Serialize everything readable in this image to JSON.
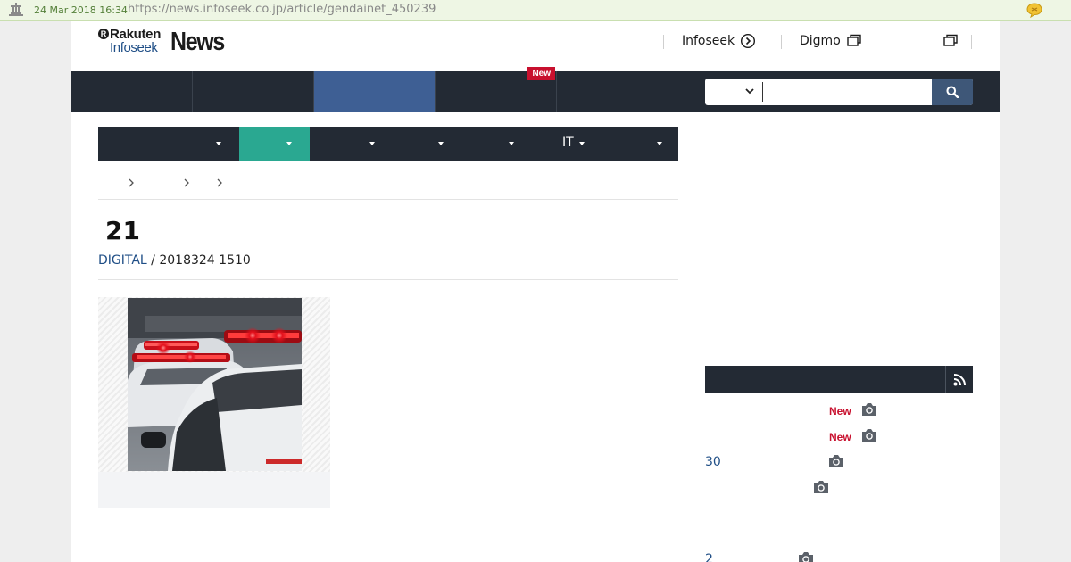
{
  "archive_bar": {
    "date": "24 Mar 2018 16:34",
    "url": "https://news.infoseek.co.jp/article/gendainet_450239"
  },
  "header": {
    "logo": {
      "rakuten": "Rakuten",
      "infoseek": "Infoseek",
      "news": "News"
    },
    "links": [
      {
        "label": "Infoseek",
        "icon": "arrow-circle-icon"
      },
      {
        "label": "Digmo",
        "icon": "external-window-icon"
      },
      {
        "label": "",
        "icon": "external-window-icon"
      }
    ]
  },
  "nav": {
    "tabs": [
      {
        "label": "",
        "active": false,
        "new": false
      },
      {
        "label": "",
        "active": false,
        "new": false
      },
      {
        "label": "",
        "active": true,
        "new": false
      },
      {
        "label": "",
        "active": false,
        "new": true
      },
      {
        "label": "",
        "active": false,
        "new": false
      }
    ],
    "new_badge": "New",
    "search": {
      "scope": "",
      "placeholder": "",
      "value": ""
    }
  },
  "categories": [
    {
      "label": "",
      "active": false
    },
    {
      "label": "",
      "active": true
    },
    {
      "label": "",
      "active": false
    },
    {
      "label": "",
      "active": false
    },
    {
      "label": "",
      "active": false
    },
    {
      "label": "IT",
      "active": false
    },
    {
      "label": "",
      "active": false
    }
  ],
  "breadcrumbs": [
    "",
    "",
    "",
    ""
  ],
  "article": {
    "title": "21",
    "source": "DIGITAL",
    "separator": " / ",
    "date": "2018324 1510"
  },
  "sidebar": {
    "ranking_title": "",
    "items": [
      {
        "num": "",
        "new": "New",
        "camera": true
      },
      {
        "num": "",
        "new": "New",
        "camera": true
      },
      {
        "num": "30",
        "new": "",
        "camera": true
      },
      {
        "num": "",
        "new": "",
        "camera": true
      },
      {
        "num": "2",
        "new": "",
        "camera": true
      }
    ]
  },
  "colors": {
    "nav_bg": "#232a34",
    "nav_active": "#3e5f94",
    "cat_active": "#2aa891",
    "link_blue": "#1f4e86",
    "new_red": "#c8102e"
  }
}
